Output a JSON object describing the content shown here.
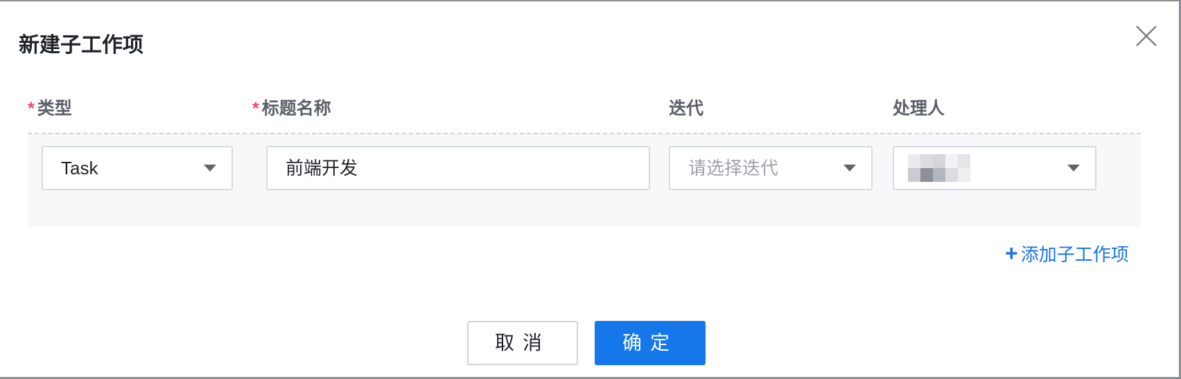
{
  "dialog": {
    "title": "新建子工作项",
    "close_icon": "close-icon"
  },
  "columns": {
    "type": {
      "required_mark": "*",
      "label": "类型"
    },
    "title_name": {
      "required_mark": "*",
      "label": "标题名称"
    },
    "iteration": {
      "label": "迭代"
    },
    "assignee": {
      "label": "处理人"
    }
  },
  "row": {
    "type_value": "Task",
    "title_value": "前端开发",
    "iteration_placeholder": "请选择迭代",
    "assignee_value": ""
  },
  "add_link": {
    "plus": "+",
    "label": "添加子工作项"
  },
  "footer": {
    "cancel_label": "取消",
    "ok_label": "确定"
  },
  "colors": {
    "primary": "#1577e9",
    "required": "#f5475a",
    "link": "#1a73e8"
  }
}
